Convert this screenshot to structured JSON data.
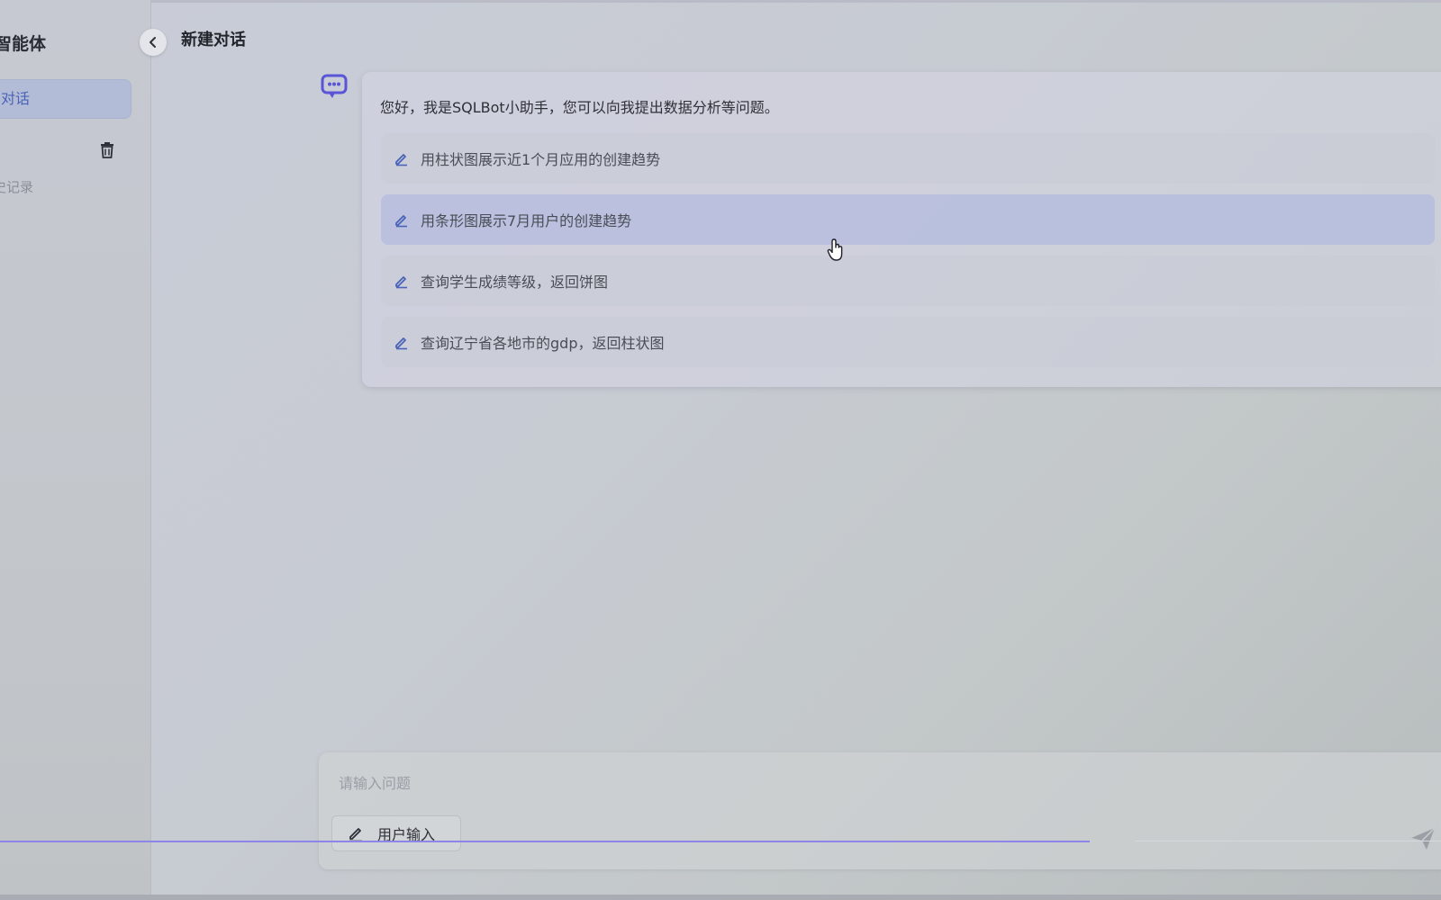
{
  "sidebar": {
    "title": "智能体",
    "new_chat_label": "对话",
    "history_label": "史记录"
  },
  "header": {
    "title": "新建对话"
  },
  "chat": {
    "greeting": "您好，我是SQLBot小助手，您可以向我提出数据分析等问题。",
    "suggestions": [
      {
        "text": "用柱状图展示近1个月应用的创建趋势"
      },
      {
        "text": "用条形图展示7月用户的创建趋势"
      },
      {
        "text": "查询学生成绩等级，返回饼图"
      },
      {
        "text": "查询辽宁省各地市的gdp，返回柱状图"
      }
    ]
  },
  "input": {
    "placeholder": "请输入问题",
    "value": "",
    "mode_label": "用户输入"
  },
  "colors": {
    "accent": "#4a63b8",
    "progress": "#8d86e8",
    "bot_icon": "#5a55d6"
  },
  "icons": {
    "collapse": "chevron-left-icon",
    "trash": "trash-icon",
    "bot": "robot-chat-icon",
    "suggestion": "edit-pen-icon",
    "mode": "pencil-icon",
    "send": "send-plane-icon",
    "cursor": "hand-pointer-icon"
  }
}
